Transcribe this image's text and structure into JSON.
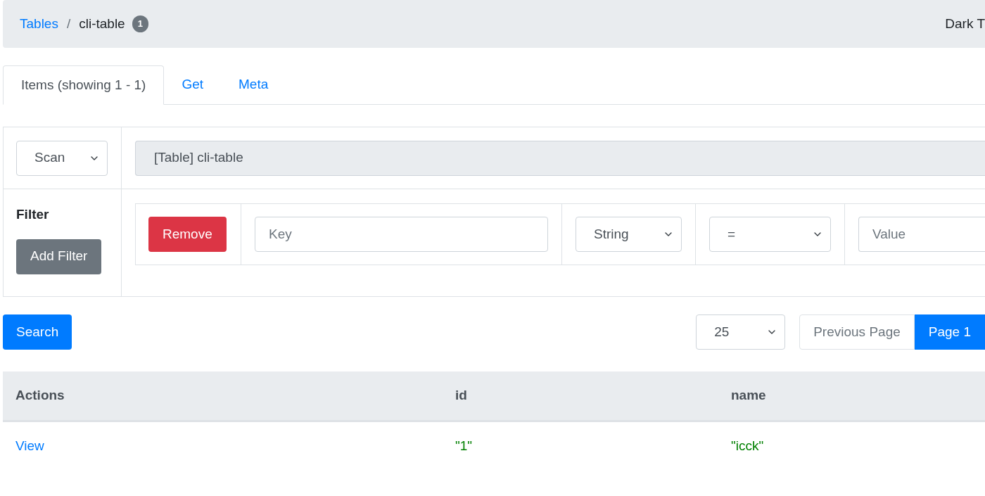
{
  "breadcrumb": {
    "items": [
      {
        "label": "Tables",
        "kind": "link"
      },
      {
        "label": "cli-table",
        "kind": "current"
      }
    ],
    "separator": "/",
    "badge": "1",
    "right_text": "Dark T"
  },
  "tabs": [
    {
      "label": "Items (showing 1 - 1)",
      "selected": true
    },
    {
      "label": "Get",
      "selected": false
    },
    {
      "label": "Meta",
      "selected": false
    }
  ],
  "query": {
    "operation": "Scan",
    "target": "[Table] cli-table"
  },
  "filter": {
    "label": "Filter",
    "add_button": "Add Filter",
    "rows": [
      {
        "remove_button": "Remove",
        "key": {
          "placeholder": "Key"
        },
        "type": "String",
        "operator": "=",
        "value": {
          "placeholder": "Value"
        }
      }
    ]
  },
  "search_button": "Search",
  "page_size": "25",
  "pagination": [
    {
      "label": "Previous Page",
      "selected": false
    },
    {
      "label": "Page 1",
      "selected": true
    }
  ],
  "results": {
    "columns": [
      "Actions",
      "id",
      "name"
    ],
    "rows": [
      {
        "cells": [
          "View",
          "\"1\"",
          "\"icck\""
        ]
      }
    ]
  }
}
